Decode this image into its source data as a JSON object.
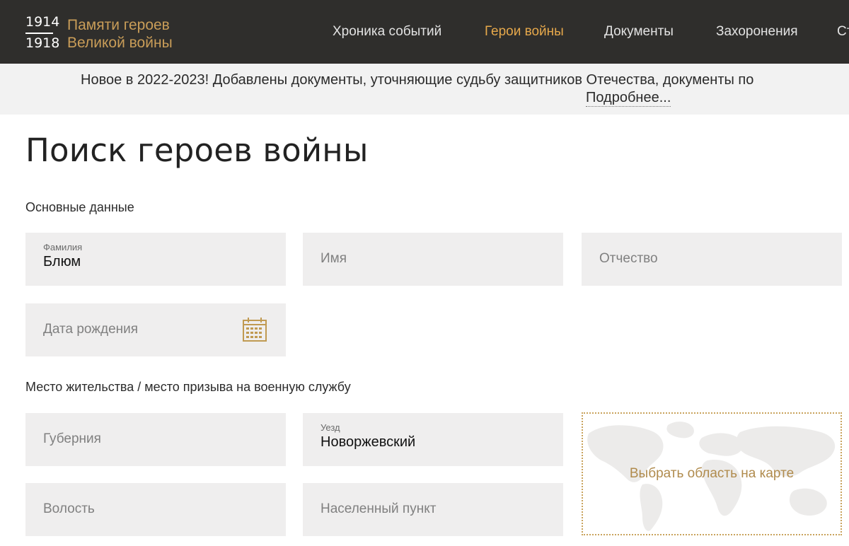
{
  "header": {
    "logo": {
      "year_start": "1914",
      "year_end": "1918",
      "title_line1": "Памяти героев",
      "title_line2": "Великой войны"
    },
    "nav": [
      {
        "label": "Хроника событий",
        "active": false
      },
      {
        "label": "Герои войны",
        "active": true
      },
      {
        "label": "Документы",
        "active": false
      },
      {
        "label": "Захоронения",
        "active": false
      },
      {
        "label": "Ст",
        "active": false
      }
    ],
    "colors": {
      "background": "#2f2e2c",
      "accent": "#e6a84b",
      "logo": "#c99d58"
    }
  },
  "notice": {
    "text": "Новое в 2022-2023! Добавлены документы, уточняющие судьбу защитников Отечества, документы по",
    "link": "Подробнее..."
  },
  "page_title": "Поиск героев войны",
  "sections": {
    "basic": {
      "label": "Основные данные",
      "surname": {
        "label": "Фамилия",
        "value": "Блюм"
      },
      "first_name": {
        "placeholder": "Имя"
      },
      "patronymic": {
        "placeholder": "Отчество"
      },
      "birth_date": {
        "placeholder": "Дата рождения",
        "icon": "calendar-icon"
      }
    },
    "residence": {
      "label": "Место жительства / место призыва на военную службу",
      "province": {
        "placeholder": "Губерния"
      },
      "district": {
        "label": "Уезд",
        "value": "Новоржевский"
      },
      "volost": {
        "placeholder": "Волость"
      },
      "settlement": {
        "placeholder": "Населенный пункт"
      },
      "map_button": "Выбрать область на карте"
    }
  }
}
